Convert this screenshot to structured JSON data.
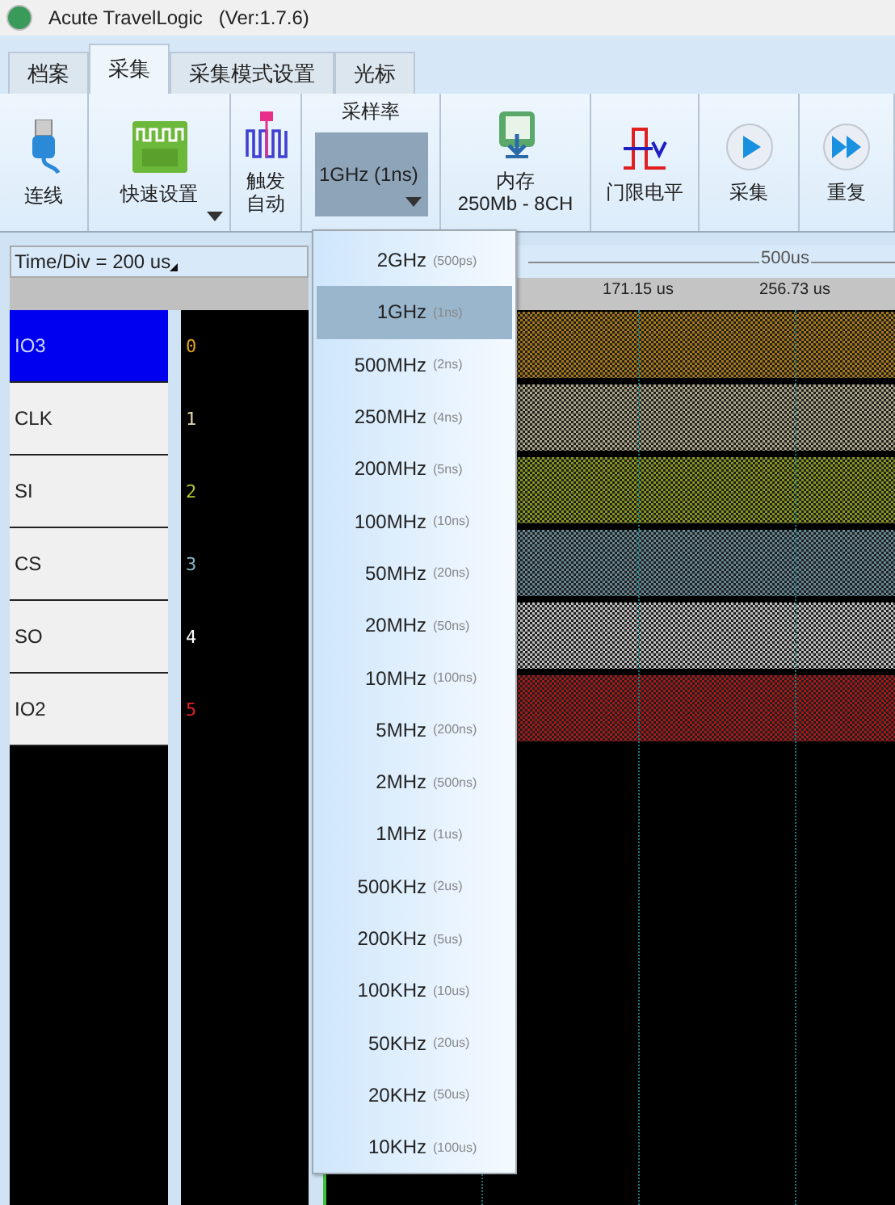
{
  "window": {
    "title": "Acute TravelLogic",
    "version": "(Ver:1.7.6)"
  },
  "tabs": [
    {
      "label": "档案",
      "selected": false
    },
    {
      "label": "采集",
      "selected": true
    },
    {
      "label": "采集模式设置",
      "selected": false
    },
    {
      "label": "光标",
      "selected": false
    }
  ],
  "ribbon": [
    {
      "kind": "usb",
      "lines": [
        "连线"
      ]
    },
    {
      "kind": "bus",
      "lines": [
        "快速设置"
      ],
      "dropdown": true
    },
    {
      "kind": "trigger",
      "lines": [
        "触发",
        "自动"
      ]
    },
    {
      "kind": "select",
      "lines": [
        "采样率"
      ],
      "value": "1GHz (1ns)",
      "dropdown": true
    },
    {
      "kind": "memory",
      "lines": [
        "内存",
        "250Mb - 8CH"
      ]
    },
    {
      "kind": "threshold",
      "lines": [
        "门限电平"
      ]
    },
    {
      "kind": "play",
      "lines": [
        "采集"
      ]
    },
    {
      "kind": "repeat",
      "lines": [
        "重复"
      ]
    }
  ],
  "time_div": "Time/Div = 200 us",
  "channels": [
    {
      "name": "IO3",
      "index": "0",
      "color": "#e0a020",
      "selected": true
    },
    {
      "name": "CLK",
      "index": "1",
      "color": "#e6dcb4",
      "selected": false
    },
    {
      "name": "SI",
      "index": "2",
      "color": "#b4c828",
      "selected": false
    },
    {
      "name": "CS",
      "index": "3",
      "color": "#88b4c4",
      "selected": false
    },
    {
      "name": "SO",
      "index": "4",
      "color": "#ffffff",
      "selected": false
    },
    {
      "name": "IO2",
      "index": "5",
      "color": "#e02020",
      "selected": false
    }
  ],
  "ruler": {
    "span": "500us",
    "ticks": [
      "171.15 us",
      "256.73 us"
    ]
  },
  "sample_rate_menu": [
    {
      "rate": "2GHz",
      "period": "(500ps)",
      "selected": false
    },
    {
      "rate": "1GHz",
      "period": "(1ns)",
      "selected": true
    },
    {
      "rate": "500MHz",
      "period": "(2ns)",
      "selected": false
    },
    {
      "rate": "250MHz",
      "period": "(4ns)",
      "selected": false
    },
    {
      "rate": "200MHz",
      "period": "(5ns)",
      "selected": false
    },
    {
      "rate": "100MHz",
      "period": "(10ns)",
      "selected": false
    },
    {
      "rate": "50MHz",
      "period": "(20ns)",
      "selected": false
    },
    {
      "rate": "20MHz",
      "period": "(50ns)",
      "selected": false
    },
    {
      "rate": "10MHz",
      "period": "(100ns)",
      "selected": false
    },
    {
      "rate": "5MHz",
      "period": "(200ns)",
      "selected": false
    },
    {
      "rate": "2MHz",
      "period": "(500ns)",
      "selected": false
    },
    {
      "rate": "1MHz",
      "period": "(1us)",
      "selected": false
    },
    {
      "rate": "500KHz",
      "period": "(2us)",
      "selected": false
    },
    {
      "rate": "200KHz",
      "period": "(5us)",
      "selected": false
    },
    {
      "rate": "100KHz",
      "period": "(10us)",
      "selected": false
    },
    {
      "rate": "50KHz",
      "period": "(20us)",
      "selected": false
    },
    {
      "rate": "20KHz",
      "period": "(50us)",
      "selected": false
    },
    {
      "rate": "10KHz",
      "period": "(100us)",
      "selected": false
    }
  ]
}
